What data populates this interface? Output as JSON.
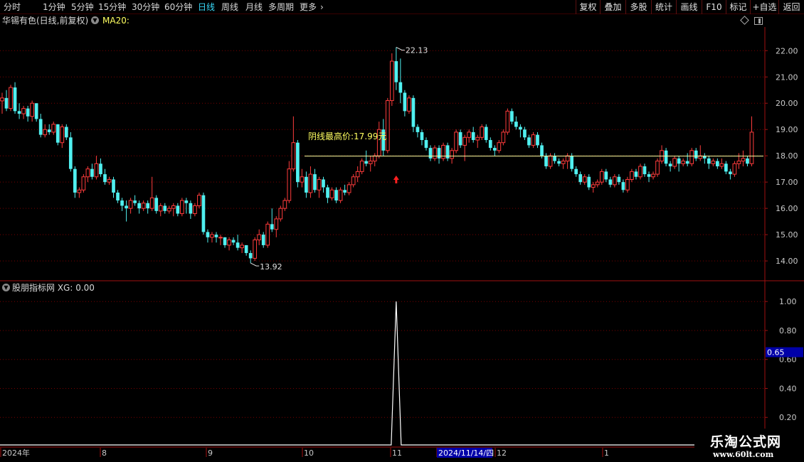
{
  "toolbar": {
    "timeframes": [
      "分时",
      "1分钟",
      "5分钟",
      "15分钟",
      "30分钟",
      "60分钟",
      "日线",
      "周线",
      "月线",
      "多周期",
      "更多"
    ],
    "active": "日线",
    "buttons": [
      "复权",
      "叠加",
      "多股",
      "统计",
      "画线",
      "F10",
      "标记",
      "+自选",
      "返回"
    ]
  },
  "main_panel": {
    "title": "华锡有色(日线,前复权)",
    "ma_label": "MA20:",
    "annotation_text": "阴线最高价:17.99元",
    "high_label": "22.13",
    "low_label": "13.92"
  },
  "indicator_panel": {
    "title": "股朋指标网 XG: 0.00",
    "current_badge": "0.65"
  },
  "watermark": {
    "title": "乐淘公式网",
    "url": "www.60lt.com"
  },
  "colors": {
    "up": "#ff3c3c",
    "down": "#50f0f0",
    "grid": "#7a0000",
    "axis_text": "#c8c8c8",
    "highlight_line": "#ffffa0",
    "annotation": "#ffff60",
    "arrow": "#ff2020",
    "badge_bg": "#0000a8"
  },
  "chart_data": [
    {
      "type": "candlestick",
      "title": "华锡有色(日线,前复权)",
      "y_ticks": [
        22,
        21,
        20,
        19,
        18,
        17,
        16,
        15,
        14
      ],
      "y_tick_labels": [
        "22.00",
        "21.00",
        "20.00",
        "19.00",
        "18.00",
        "17.00",
        "16.00",
        "15.00",
        "14.00"
      ],
      "ylim": [
        13.3,
        22.9
      ],
      "highest": 22.13,
      "lowest": 13.92,
      "reference_line": 17.99,
      "x_labels": [
        "2024年",
        "8",
        "9",
        "10",
        "11",
        "2024/11/14/四",
        "12",
        "1"
      ],
      "grid": true,
      "ohlc": [
        [
          20.09,
          20.4,
          19.6,
          20.2
        ],
        [
          20.2,
          20.5,
          19.7,
          19.8
        ],
        [
          19.8,
          20.7,
          19.7,
          20.6
        ],
        [
          20.6,
          20.8,
          19.6,
          19.7
        ],
        [
          19.7,
          20.0,
          19.4,
          19.6
        ],
        [
          19.6,
          19.9,
          19.4,
          19.8
        ],
        [
          19.8,
          19.9,
          19.3,
          19.5
        ],
        [
          19.5,
          20.1,
          19.3,
          20.0
        ],
        [
          20.0,
          20.0,
          19.3,
          19.4
        ],
        [
          19.4,
          19.6,
          18.7,
          18.8
        ],
        [
          18.8,
          19.2,
          18.7,
          19.0
        ],
        [
          19.0,
          19.2,
          18.8,
          18.9
        ],
        [
          18.9,
          19.3,
          18.8,
          19.2
        ],
        [
          19.2,
          19.2,
          18.4,
          18.5
        ],
        [
          18.5,
          19.2,
          18.3,
          19.1
        ],
        [
          19.1,
          19.2,
          18.6,
          18.7
        ],
        [
          18.7,
          18.9,
          17.4,
          17.5
        ],
        [
          17.5,
          17.6,
          16.4,
          16.6
        ],
        [
          16.6,
          16.8,
          16.4,
          16.7
        ],
        [
          16.7,
          17.3,
          16.6,
          17.2
        ],
        [
          17.2,
          17.6,
          17.0,
          17.5
        ],
        [
          17.5,
          17.7,
          17.1,
          17.2
        ],
        [
          17.2,
          18.0,
          17.1,
          17.7
        ],
        [
          17.7,
          17.9,
          17.2,
          17.3
        ],
        [
          17.3,
          17.5,
          16.9,
          17.0
        ],
        [
          17.0,
          17.2,
          16.9,
          17.1
        ],
        [
          17.1,
          17.2,
          16.4,
          16.6
        ],
        [
          16.6,
          16.7,
          16.2,
          16.3
        ],
        [
          16.3,
          16.4,
          15.9,
          16.1
        ],
        [
          16.1,
          16.3,
          15.5,
          16.0
        ],
        [
          16.0,
          16.4,
          15.8,
          16.3
        ],
        [
          16.3,
          16.5,
          16.1,
          16.2
        ],
        [
          16.2,
          16.3,
          15.8,
          16.0
        ],
        [
          16.0,
          16.3,
          15.9,
          16.2
        ],
        [
          16.2,
          16.3,
          15.8,
          16.0
        ],
        [
          16.0,
          17.2,
          15.9,
          16.4
        ],
        [
          16.4,
          16.5,
          15.8,
          15.9
        ],
        [
          15.9,
          16.2,
          15.7,
          16.1
        ],
        [
          16.1,
          16.2,
          15.8,
          15.9
        ],
        [
          15.9,
          16.1,
          15.8,
          16.0
        ],
        [
          16.0,
          16.2,
          15.7,
          16.1
        ],
        [
          16.1,
          16.2,
          15.7,
          15.8
        ],
        [
          15.8,
          16.4,
          15.7,
          16.3
        ],
        [
          16.3,
          16.4,
          15.8,
          16.2
        ],
        [
          16.2,
          16.3,
          15.6,
          15.8
        ],
        [
          15.8,
          16.2,
          15.7,
          16.1
        ],
        [
          16.1,
          16.6,
          16.0,
          16.5
        ],
        [
          16.5,
          16.6,
          15.0,
          15.1
        ],
        [
          15.1,
          15.2,
          14.7,
          14.9
        ],
        [
          14.9,
          15.1,
          14.7,
          15.0
        ],
        [
          15.0,
          15.1,
          14.7,
          14.9
        ],
        [
          14.9,
          15.0,
          14.6,
          14.9
        ],
        [
          14.9,
          14.9,
          14.5,
          14.6
        ],
        [
          14.6,
          14.9,
          14.4,
          14.8
        ],
        [
          14.8,
          14.9,
          14.6,
          14.7
        ],
        [
          14.7,
          15.0,
          14.4,
          14.5
        ],
        [
          14.5,
          14.7,
          14.3,
          14.6
        ],
        [
          14.6,
          14.6,
          14.2,
          14.3
        ],
        [
          14.3,
          14.4,
          13.92,
          14.1
        ],
        [
          14.1,
          14.9,
          14.0,
          14.8
        ],
        [
          14.8,
          15.2,
          14.6,
          15.0
        ],
        [
          15.0,
          15.1,
          14.5,
          14.6
        ],
        [
          14.6,
          15.5,
          14.5,
          15.4
        ],
        [
          15.4,
          16.0,
          15.1,
          15.2
        ],
        [
          15.2,
          15.7,
          14.9,
          15.6
        ],
        [
          15.6,
          16.1,
          15.5,
          16.0
        ],
        [
          16.0,
          16.4,
          15.9,
          16.3
        ],
        [
          16.3,
          17.8,
          16.2,
          17.5
        ],
        [
          17.5,
          19.5,
          17.4,
          18.5
        ],
        [
          18.5,
          18.6,
          16.8,
          17.0
        ],
        [
          17.0,
          17.5,
          16.8,
          17.2
        ],
        [
          17.2,
          17.4,
          16.4,
          16.6
        ],
        [
          16.6,
          17.6,
          16.4,
          17.3
        ],
        [
          17.3,
          17.5,
          16.6,
          16.7
        ],
        [
          16.7,
          17.2,
          16.4,
          17.1
        ],
        [
          17.1,
          17.2,
          16.6,
          16.8
        ],
        [
          16.8,
          16.9,
          16.2,
          16.4
        ],
        [
          16.4,
          16.8,
          16.3,
          16.7
        ],
        [
          16.7,
          16.8,
          16.2,
          16.3
        ],
        [
          16.3,
          16.8,
          16.2,
          16.7
        ],
        [
          16.7,
          16.9,
          16.5,
          16.6
        ],
        [
          16.6,
          17.0,
          16.5,
          16.9
        ],
        [
          16.9,
          17.3,
          16.8,
          17.2
        ],
        [
          17.2,
          17.6,
          17.0,
          17.4
        ],
        [
          17.4,
          17.9,
          17.3,
          17.8
        ],
        [
          17.8,
          18.2,
          17.6,
          17.7
        ],
        [
          17.7,
          18.0,
          17.4,
          17.8
        ],
        [
          17.8,
          18.1,
          17.6,
          18.0
        ],
        [
          18.0,
          19.3,
          17.9,
          19.0
        ],
        [
          19.0,
          19.4,
          18.0,
          18.2
        ],
        [
          18.2,
          20.2,
          18.1,
          20.1
        ],
        [
          20.1,
          21.9,
          19.9,
          21.6
        ],
        [
          21.6,
          22.13,
          20.5,
          20.8
        ],
        [
          20.8,
          21.7,
          20.0,
          20.4
        ],
        [
          20.4,
          20.5,
          19.5,
          19.7
        ],
        [
          19.7,
          20.3,
          19.6,
          20.2
        ],
        [
          20.2,
          20.3,
          18.9,
          19.1
        ],
        [
          19.1,
          19.2,
          18.7,
          18.9
        ],
        [
          18.9,
          19.0,
          18.4,
          18.6
        ],
        [
          18.6,
          18.7,
          18.2,
          18.3
        ],
        [
          18.3,
          18.4,
          17.8,
          17.9
        ],
        [
          17.9,
          18.4,
          17.8,
          18.3
        ],
        [
          18.3,
          18.4,
          17.7,
          17.9
        ],
        [
          17.9,
          18.5,
          17.8,
          18.4
        ],
        [
          18.4,
          18.5,
          17.8,
          17.9
        ],
        [
          17.9,
          18.3,
          17.7,
          18.2
        ],
        [
          18.2,
          19.0,
          18.1,
          18.9
        ],
        [
          18.9,
          19.0,
          18.3,
          18.4
        ],
        [
          18.4,
          18.8,
          17.8,
          18.7
        ],
        [
          18.7,
          19.0,
          18.5,
          18.9
        ],
        [
          18.9,
          19.1,
          18.5,
          18.6
        ],
        [
          18.6,
          18.8,
          18.3,
          18.7
        ],
        [
          18.7,
          19.2,
          18.6,
          19.1
        ],
        [
          19.1,
          19.2,
          18.5,
          18.6
        ],
        [
          18.6,
          18.7,
          18.2,
          18.3
        ],
        [
          18.3,
          18.4,
          18.0,
          18.2
        ],
        [
          18.2,
          18.6,
          18.1,
          18.5
        ],
        [
          18.5,
          19.0,
          18.4,
          18.9
        ],
        [
          18.9,
          19.8,
          18.8,
          19.7
        ],
        [
          19.7,
          19.8,
          19.2,
          19.3
        ],
        [
          19.3,
          19.5,
          19.0,
          19.1
        ],
        [
          19.1,
          19.2,
          18.7,
          19.0
        ],
        [
          19.0,
          19.1,
          18.6,
          18.7
        ],
        [
          18.7,
          18.8,
          18.3,
          18.4
        ],
        [
          18.4,
          18.9,
          18.3,
          18.8
        ],
        [
          18.8,
          18.9,
          18.3,
          18.4
        ],
        [
          18.4,
          18.5,
          17.9,
          18.0
        ],
        [
          18.0,
          18.1,
          17.5,
          17.6
        ],
        [
          17.6,
          18.1,
          17.5,
          18.0
        ],
        [
          18.0,
          18.1,
          17.7,
          17.8
        ],
        [
          17.8,
          17.9,
          17.6,
          17.7
        ],
        [
          17.7,
          17.9,
          17.5,
          17.8
        ],
        [
          17.8,
          18.1,
          17.5,
          18.0
        ],
        [
          18.0,
          18.1,
          17.4,
          17.5
        ],
        [
          17.5,
          17.6,
          17.2,
          17.3
        ],
        [
          17.3,
          17.4,
          16.9,
          17.0
        ],
        [
          17.0,
          17.3,
          16.9,
          17.2
        ],
        [
          17.2,
          17.3,
          16.7,
          16.8
        ],
        [
          16.8,
          17.0,
          16.6,
          16.9
        ],
        [
          16.9,
          17.1,
          16.8,
          17.0
        ],
        [
          17.0,
          17.5,
          16.9,
          17.4
        ],
        [
          17.4,
          17.5,
          17.0,
          17.1
        ],
        [
          17.1,
          17.2,
          16.8,
          16.9
        ],
        [
          16.9,
          17.3,
          16.8,
          17.2
        ],
        [
          17.2,
          17.3,
          16.9,
          17.0
        ],
        [
          17.0,
          17.1,
          16.6,
          16.7
        ],
        [
          16.7,
          17.2,
          16.6,
          17.1
        ],
        [
          17.1,
          17.5,
          17.0,
          17.4
        ],
        [
          17.4,
          17.5,
          17.1,
          17.2
        ],
        [
          17.2,
          17.7,
          17.1,
          17.6
        ],
        [
          17.6,
          17.7,
          17.2,
          17.3
        ],
        [
          17.3,
          17.4,
          17.0,
          17.2
        ],
        [
          17.2,
          17.4,
          17.1,
          17.3
        ],
        [
          17.3,
          17.9,
          17.2,
          17.8
        ],
        [
          17.8,
          18.4,
          17.7,
          18.2
        ],
        [
          18.2,
          18.3,
          17.6,
          17.7
        ],
        [
          17.7,
          17.8,
          17.4,
          17.6
        ],
        [
          17.6,
          18.0,
          17.5,
          17.9
        ],
        [
          17.9,
          18.0,
          17.4,
          17.7
        ],
        [
          17.7,
          17.9,
          17.6,
          17.8
        ],
        [
          17.8,
          18.1,
          17.6,
          17.7
        ],
        [
          17.7,
          18.3,
          17.6,
          18.2
        ],
        [
          18.2,
          18.3,
          17.8,
          17.9
        ],
        [
          17.9,
          18.4,
          17.8,
          18.0
        ],
        [
          18.0,
          18.1,
          17.7,
          17.9
        ],
        [
          17.9,
          18.0,
          17.5,
          17.7
        ],
        [
          17.7,
          17.9,
          17.6,
          17.8
        ],
        [
          17.8,
          17.9,
          17.5,
          17.6
        ],
        [
          17.6,
          17.9,
          17.5,
          17.7
        ],
        [
          17.7,
          17.8,
          17.3,
          17.4
        ],
        [
          17.4,
          17.5,
          17.1,
          17.3
        ],
        [
          17.3,
          17.8,
          17.2,
          17.7
        ],
        [
          17.7,
          18.1,
          17.5,
          17.8
        ],
        [
          17.8,
          18.2,
          17.6,
          17.9
        ],
        [
          17.9,
          18.0,
          17.6,
          17.7
        ],
        [
          17.7,
          19.5,
          17.6,
          18.9
        ]
      ]
    },
    {
      "type": "line",
      "title": "股朋指标网 XG: 0.00",
      "y_ticks": [
        1.0,
        0.8,
        0.6,
        0.4,
        0.2
      ],
      "y_tick_labels": [
        "1.00",
        "0.80",
        "0.60",
        "0.40",
        "0.20"
      ],
      "ylim": [
        0,
        1.05
      ],
      "current_value": 0.65,
      "grid": true,
      "spike_index": 92,
      "spike_value": 1.0
    }
  ]
}
